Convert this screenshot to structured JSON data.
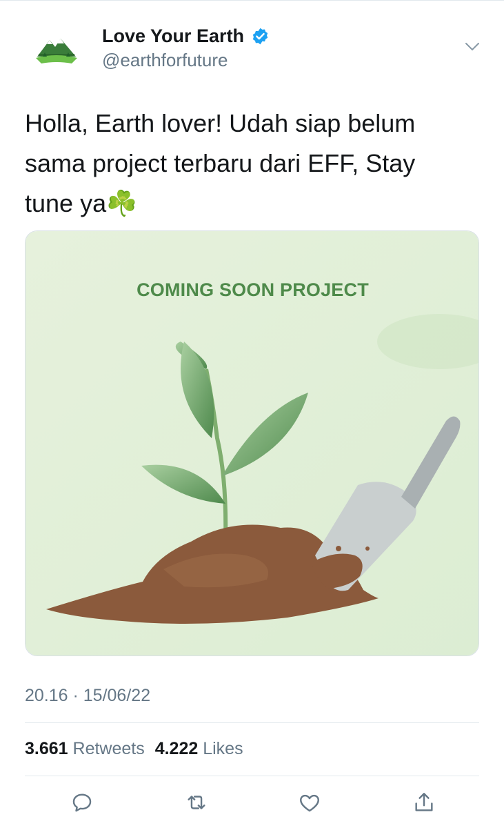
{
  "tweet": {
    "display_name": "Love Your Earth",
    "verified_icon": "verified-badge-icon",
    "handle": "@earthforfuture",
    "text": "Holla, Earth lover! Udah siap belum sama project terbaru dari EFF, Stay tune ya☘️",
    "media": {
      "title": "COMING SOON PROJECT",
      "description_icons": [
        "seedling-illustration",
        "soil-mound",
        "trowel"
      ]
    },
    "timestamp": "20.16 · 15/06/22",
    "stats": {
      "retweets_count": "3.661",
      "retweets_label": "Retweets",
      "likes_count": "4.222",
      "likes_label": "Likes"
    },
    "actions": [
      "reply-icon",
      "retweet-icon",
      "like-icon",
      "share-icon"
    ]
  },
  "colors": {
    "text_primary": "#14171a",
    "text_secondary": "#657786",
    "verified": "#1da1f2",
    "media_title": "#4e8a4a",
    "divider": "#e1e8ed"
  }
}
